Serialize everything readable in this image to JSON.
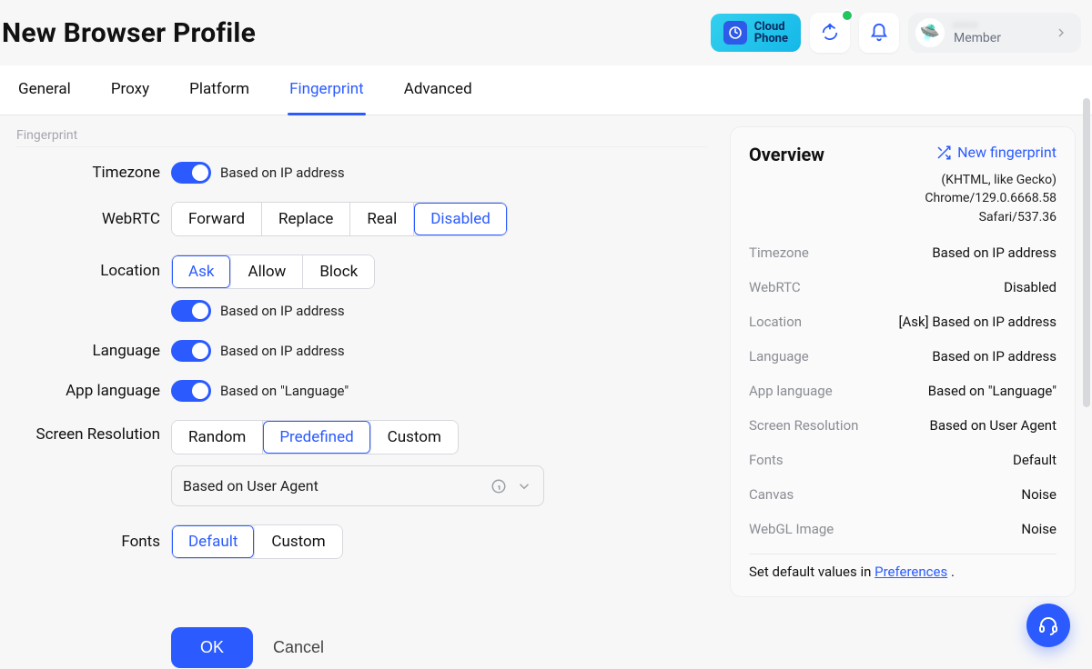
{
  "header": {
    "title": "New Browser Profile",
    "cloudphone": {
      "line1": "Cloud",
      "line2": "Phone"
    },
    "member": {
      "name": "• • • •",
      "role": "Member"
    }
  },
  "tabs": {
    "items": [
      "General",
      "Proxy",
      "Platform",
      "Fingerprint",
      "Advanced"
    ],
    "active_index": 3
  },
  "section_hint": "Fingerprint",
  "form": {
    "timezone": {
      "label": "Timezone",
      "hint": "Based on IP address",
      "on": true
    },
    "webrtc": {
      "label": "WebRTC",
      "options": [
        "Forward",
        "Replace",
        "Real",
        "Disabled"
      ],
      "active_index": 3
    },
    "location": {
      "label": "Location",
      "options": [
        "Ask",
        "Allow",
        "Block"
      ],
      "active_index": 0,
      "hint": "Based on IP address",
      "on": true
    },
    "language": {
      "label": "Language",
      "hint": "Based on IP address",
      "on": true
    },
    "app_language": {
      "label": "App language",
      "hint": "Based on \"Language\"",
      "on": true
    },
    "screen": {
      "label": "Screen Resolution",
      "options": [
        "Random",
        "Predefined",
        "Custom"
      ],
      "active_index": 1,
      "select_value": "Based on User Agent"
    },
    "fonts": {
      "label": "Fonts",
      "options": [
        "Default",
        "Custom"
      ],
      "active_index": 0
    }
  },
  "buttons": {
    "ok": "OK",
    "cancel": "Cancel"
  },
  "overview": {
    "title": "Overview",
    "new_fp": "New fingerprint",
    "ua_lines": [
      "(KHTML, like Gecko)",
      "Chrome/129.0.6668.58",
      "Safari/537.36"
    ],
    "rows": [
      {
        "k": "Timezone",
        "v": "Based on IP address"
      },
      {
        "k": "WebRTC",
        "v": "Disabled"
      },
      {
        "k": "Location",
        "v": "[Ask] Based on IP address"
      },
      {
        "k": "Language",
        "v": "Based on IP address"
      },
      {
        "k": "App language",
        "v": "Based on \"Language\""
      },
      {
        "k": "Screen Resolution",
        "v": "Based on User Agent"
      },
      {
        "k": "Fonts",
        "v": "Default"
      },
      {
        "k": "Canvas",
        "v": "Noise"
      },
      {
        "k": "WebGL Image",
        "v": "Noise"
      }
    ],
    "pref_text_pre": "Set default values in ",
    "pref_link": "Preferences",
    "pref_text_post": " ."
  }
}
